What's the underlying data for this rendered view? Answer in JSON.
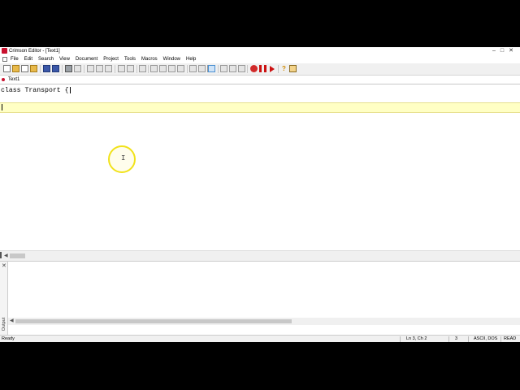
{
  "window": {
    "title": "Crimson Editor - [Text1]"
  },
  "menu": {
    "items": [
      "File",
      "Edit",
      "Search",
      "View",
      "Document",
      "Project",
      "Tools",
      "Macros",
      "Window",
      "Help"
    ]
  },
  "tabs": [
    {
      "label": "Text1"
    }
  ],
  "editor": {
    "lines": [
      "class Transport {",
      "",
      ""
    ]
  },
  "status": {
    "ready": "Ready",
    "position": "Ln 3, Ch 2",
    "count": "3",
    "encoding": "ASCII, DOS",
    "mode": "READ"
  },
  "output_panel": {
    "label": "Output"
  },
  "colors": {
    "current_line": "#ffffc4",
    "mouse_ring": "#f1e21a",
    "brand": "#c8102e"
  }
}
